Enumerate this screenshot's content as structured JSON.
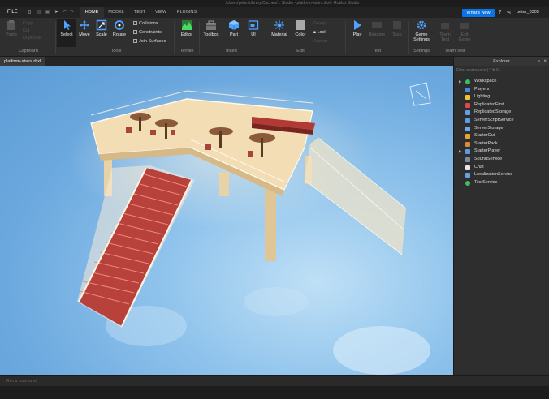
{
  "window": {
    "title": "/Users/peter/Library/Caches/... Studio - platform-stairs.rbxl - Roblox Studio"
  },
  "menubar": {
    "file": "FILE",
    "tabs": [
      "HOME",
      "MODEL",
      "TEST",
      "VIEW",
      "PLUGINS"
    ],
    "active_tab": "HOME",
    "whats_new": "What's New",
    "username": "peter_0305"
  },
  "ribbon": {
    "clipboard": {
      "group": "Clipboard",
      "paste": "Paste",
      "copy": "Copy",
      "cut": "Cut",
      "duplicate": "Duplicate"
    },
    "tools": {
      "group": "Tools",
      "select": "Select",
      "move": "Move",
      "scale": "Scale",
      "rotate": "Rotate",
      "collisions": "Collisions",
      "constraints": "Constraints",
      "join_surfaces": "Join Surfaces"
    },
    "terrain": {
      "group": "Terrain",
      "editor": "Editor"
    },
    "insert": {
      "group": "Insert",
      "toolbox": "Toolbox",
      "part": "Part",
      "ui": "UI"
    },
    "edit": {
      "group": "Edit",
      "material": "Material",
      "color": "Color",
      "group_btn": "Group",
      "lock": "Lock",
      "anchor": "Anchor"
    },
    "test": {
      "group": "Test",
      "play": "Play",
      "resume": "Resume",
      "stop": "Stop"
    },
    "settings": {
      "group": "Settings",
      "game_settings": "Game Settings"
    },
    "team_test": {
      "group": "Team Test",
      "team_test": "Team Test",
      "exit_game": "Exit Game"
    }
  },
  "document": {
    "tab_label": "platform-stairs.rbxl"
  },
  "explorer": {
    "title": "Explorer",
    "filter_placeholder": "Filter workspace (⌃⌘X)",
    "items": [
      {
        "label": "Workspace",
        "expandable": true,
        "icon_color": "#3cc05f"
      },
      {
        "label": "Players",
        "expandable": false,
        "icon_color": "#4a86d9"
      },
      {
        "label": "Lighting",
        "expandable": false,
        "icon_color": "#f2c230"
      },
      {
        "label": "ReplicatedFirst",
        "expandable": false,
        "icon_color": "#d94a4a"
      },
      {
        "label": "ReplicatedStorage",
        "expandable": false,
        "icon_color": "#6a9be6"
      },
      {
        "label": "ServerScriptService",
        "expandable": false,
        "icon_color": "#5aa0e0"
      },
      {
        "label": "ServerStorage",
        "expandable": false,
        "icon_color": "#6aa8e8"
      },
      {
        "label": "StarterGui",
        "expandable": false,
        "icon_color": "#e5a33a"
      },
      {
        "label": "StarterPack",
        "expandable": false,
        "icon_color": "#d98a3a"
      },
      {
        "label": "StarterPlayer",
        "expandable": true,
        "icon_color": "#5a9ae0"
      },
      {
        "label": "SoundService",
        "expandable": false,
        "icon_color": "#7a8aa0"
      },
      {
        "label": "Chat",
        "expandable": false,
        "icon_color": "#e6e6e6"
      },
      {
        "label": "LocalizationService",
        "expandable": false,
        "icon_color": "#6aa0e0"
      },
      {
        "label": "TestService",
        "expandable": false,
        "icon_color": "#3cc05f"
      }
    ]
  },
  "command_bar": {
    "placeholder": "Run a command"
  },
  "colors": {
    "accent": "#0a74e6",
    "panel": "#2e2e2e",
    "ribbon": "#2f2f2f"
  }
}
